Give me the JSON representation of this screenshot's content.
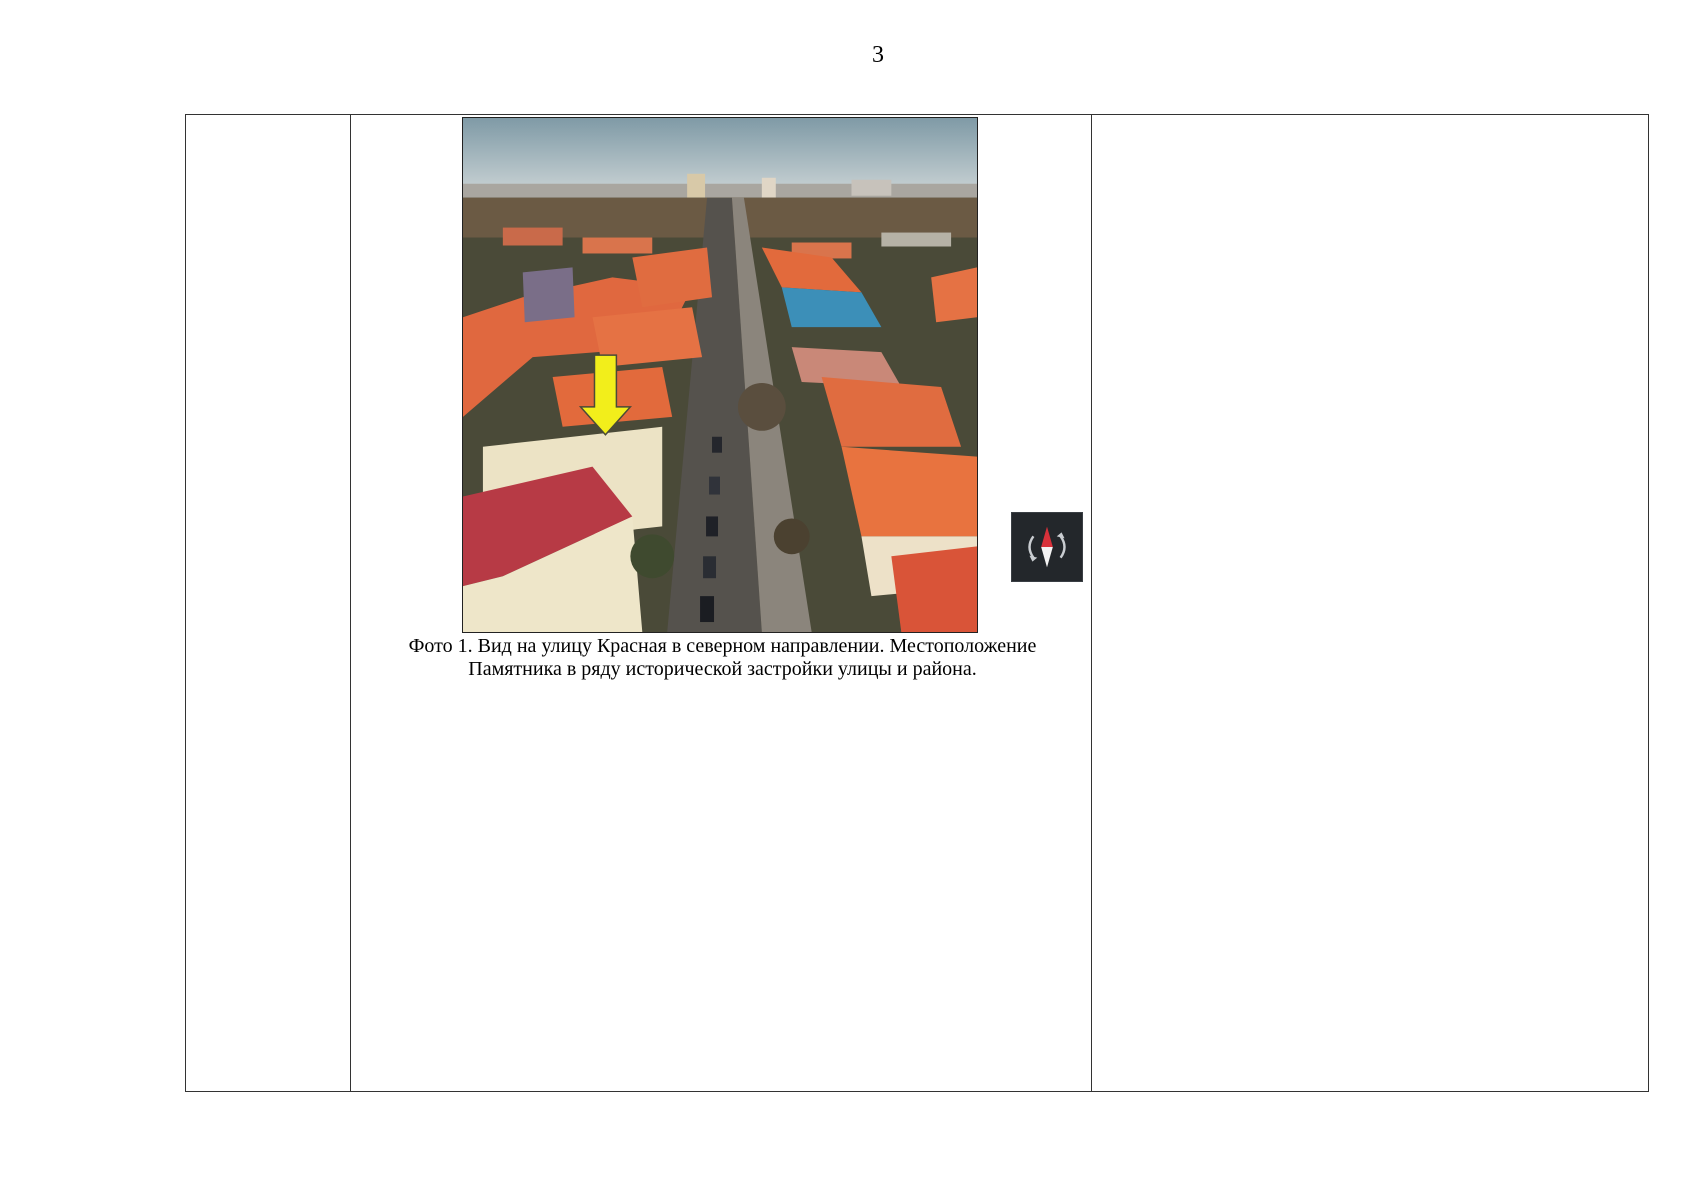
{
  "page": {
    "number": "3"
  },
  "figure": {
    "caption_line1": "Фото 1. Вид на улицу Красная в северном направлении. Местоположение",
    "caption_line2": "Памятника в ряду исторической застройки улицы и района.",
    "marker_color": "#f2ee1b",
    "roof_color": "#e0683f"
  },
  "icons": {
    "marker": "down-arrow-icon",
    "compass": "compass-rotate-icon"
  }
}
